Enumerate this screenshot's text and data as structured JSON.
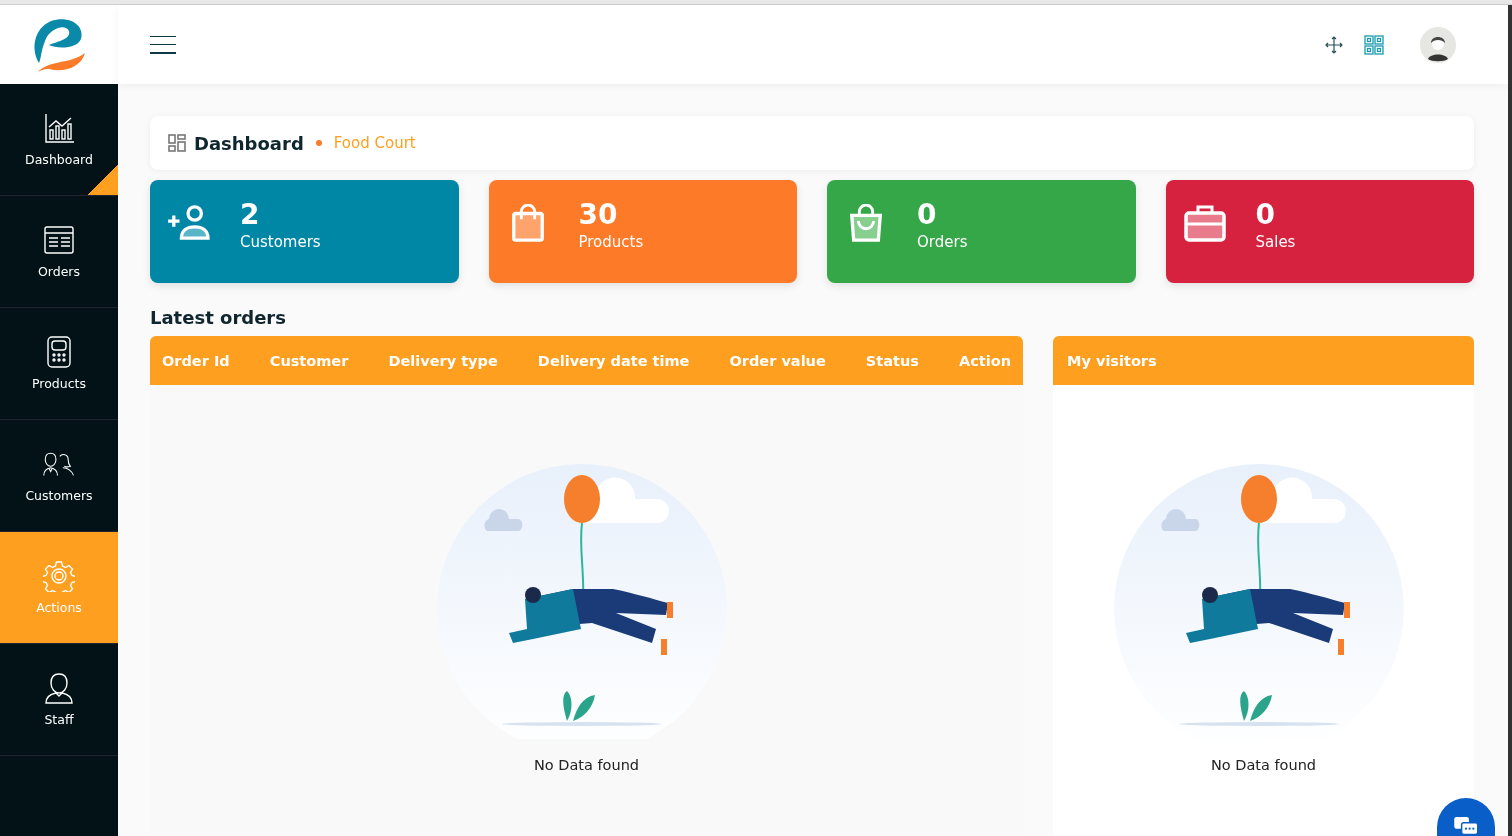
{
  "sidebar": {
    "items": [
      {
        "label": "Dashboard",
        "selected": false,
        "active": true
      },
      {
        "label": "Orders",
        "selected": false,
        "active": false
      },
      {
        "label": "Products",
        "selected": false,
        "active": false
      },
      {
        "label": "Customers",
        "selected": false,
        "active": false
      },
      {
        "label": "Actions",
        "selected": true,
        "active": false
      },
      {
        "label": "Staff",
        "selected": false,
        "active": false
      }
    ]
  },
  "breadcrumb": {
    "title": "Dashboard",
    "current": "Food Court"
  },
  "stats": [
    {
      "value": "2",
      "label": "Customers",
      "color": "#0087a6"
    },
    {
      "value": "30",
      "label": "Products",
      "color": "#fd7a28"
    },
    {
      "value": "0",
      "label": "Orders",
      "color": "#36a748"
    },
    {
      "value": "0",
      "label": "Sales",
      "color": "#d6223f"
    }
  ],
  "latest_orders": {
    "title": "Latest orders",
    "columns": [
      "Order Id",
      "Customer",
      "Delivery type",
      "Delivery date time",
      "Order value",
      "Status",
      "Action"
    ],
    "empty_text": "No Data found"
  },
  "visitors": {
    "title": "My visitors",
    "empty_text": "No Data found"
  }
}
